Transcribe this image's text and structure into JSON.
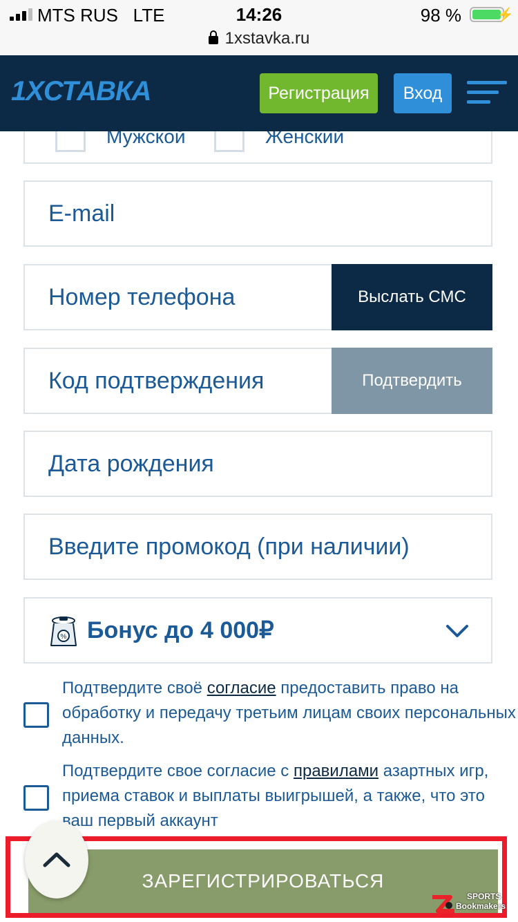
{
  "status_bar": {
    "carrier": "MTS RUS",
    "network": "LTE",
    "time": "14:26",
    "battery": "98 %",
    "battery_level": 0.98,
    "url": "1xstavka.ru"
  },
  "header": {
    "logo": "1XСТАВКА",
    "register_label": "Регистрация",
    "login_label": "Вход",
    "accent_color": "#2f8fd8",
    "register_color": "#72b82e",
    "background_color": "#0c2a46"
  },
  "form": {
    "gender": {
      "male": "Мужской",
      "female": "Женский"
    },
    "email_placeholder": "E-mail",
    "phone_placeholder": "Номер телефона",
    "send_sms_label": "Выслать СМС",
    "code_placeholder": "Код подтверждения",
    "confirm_label": "Подтвердить",
    "birthdate_placeholder": "Дата рождения",
    "promo_placeholder": "Введите промокод (при наличии)",
    "bonus_label": "Бонус до 4 000₽"
  },
  "consents": {
    "personal_data": {
      "prefix": "Подтвердите своё ",
      "link": "согласие",
      "suffix": " предоставить право на обработку и передачу третьим лицам своих персональных данных."
    },
    "rules": {
      "prefix": "Подтвердите свое согласие с ",
      "link": "правилами",
      "suffix": " азартных игр, приема ставок и выплаты выигрышей, а также, что это ваш первый аккаунт"
    }
  },
  "submit": {
    "label": "ЗАРЕГИСТРИРОВАТЬСЯ",
    "highlight_color": "#ec1c2b"
  },
  "watermark": {
    "line1": "SPORTS",
    "line2": "Bookmakers"
  }
}
